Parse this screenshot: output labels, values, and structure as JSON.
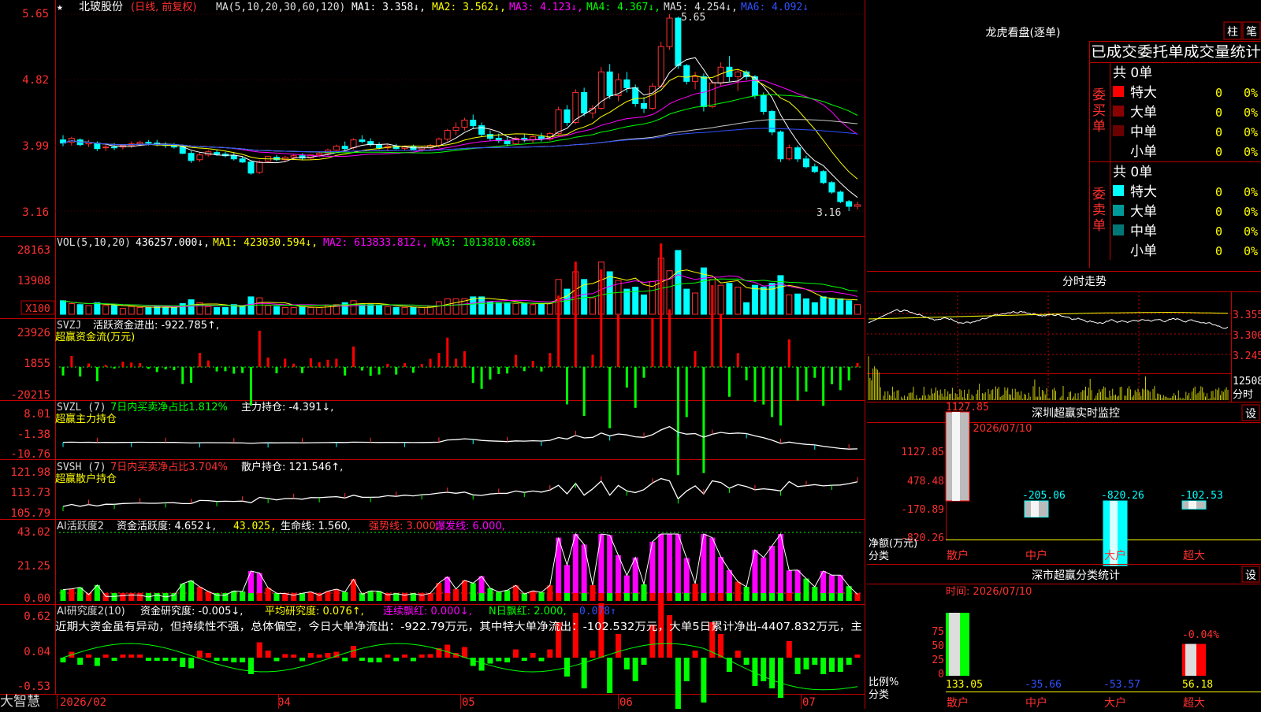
{
  "stock": {
    "star": "★",
    "name": "北玻股份",
    "mode": "(日线, 前复权)",
    "ma_label": "MA(5,10,20,30,60,120)",
    "ma1": "MA1: 3.358↓,",
    "ma2": "MA2: 3.562↓,",
    "ma3": "MA3: 4.123↓,",
    "ma4": "MA4: 4.367↓,",
    "ma5": "MA5: 4.254↓,",
    "ma6": "MA6: 4.092↓"
  },
  "price_axis": [
    "5.65",
    "4.82",
    "3.99",
    "3.16"
  ],
  "price_high_label": "5.65",
  "price_low_label": "3.16",
  "vol": {
    "label": "VOL(5,10,20)",
    "value": "436257.000↓,",
    "ma1": "MA1: 423030.594↓,",
    "ma2": "MA2: 613833.812↓,",
    "ma3": "MA3: 1013810.688↓",
    "axis": [
      "28163",
      "13908"
    ],
    "unit": "X100"
  },
  "svzj": {
    "label": "SVZJ",
    "value": "活跃资金进出: -922.785↑,",
    "sub": "超赢资金流(万元)",
    "axis": [
      "23926",
      "1855",
      "-20215"
    ]
  },
  "svzl": {
    "label": "SVZL (7)",
    "ratio": "7日内买卖净占比1.812%",
    "value": "主力持仓: -4.391↓,",
    "sub": "超赢主力持仓",
    "axis": [
      "8.01",
      "-1.38",
      "-10.76"
    ]
  },
  "svsh": {
    "label": "SVSH (7)",
    "ratio": "7日内买卖净占比3.704%",
    "value": "散户持仓: 121.546↑,",
    "sub": "超赢散户持仓",
    "axis": [
      "121.98",
      "113.73",
      "105.79"
    ]
  },
  "ai1": {
    "label": "AI活跃度2",
    "v1": "资金活跃度: 4.652↓,",
    "v2": "43.025,",
    "v3": "生命线: 1.560,",
    "v4": "强势线: 3.000,",
    "v5": "爆发线: 6.000,",
    "axis": [
      "43.02",
      "21.25",
      "0.00"
    ]
  },
  "ai2": {
    "label": "AI研究度2(10)",
    "v1": "资金研究度: -0.005↓,",
    "v2": "平均研究度: 0.076↑,",
    "v3": "连续飘红: 0.000↓,",
    "v4": "N日飘红: 2.000,",
    "v5": "0.078↑",
    "comment": "近期大资金虽有异动，但持续性不强，总体偏空，今日大单净流出：-922.79万元，其中特大单净流出：-102.532万元，大单5日累计净出-4407.832万元，主",
    "axis": [
      "0.62",
      "0.04",
      "-0.53"
    ]
  },
  "dates": [
    "2026/02",
    "04",
    "05",
    "06",
    "07"
  ],
  "brand": "大智慧",
  "lhb": {
    "title": "龙虎看盘(逐单)",
    "btn_zhu": "柱",
    "btn_bi": "笔",
    "tabs": "已成交委托单成交量统计",
    "buy_label": "委买单",
    "sell_label": "委卖单",
    "buy_total": "共 0单",
    "sell_total": "共 0单",
    "buy_rows": [
      {
        "name": "特大",
        "count": "0",
        "pct": "0%",
        "color": "#ff0000"
      },
      {
        "name": "大单",
        "count": "0",
        "pct": "0%",
        "color": "#8b0000"
      },
      {
        "name": "中单",
        "count": "0",
        "pct": "0%",
        "color": "#6b0000"
      },
      {
        "name": "小单",
        "count": "0",
        "pct": "0%",
        "color": "#000000"
      }
    ],
    "sell_rows": [
      {
        "name": "特大",
        "count": "0",
        "pct": "0%",
        "color": "#00ffff"
      },
      {
        "name": "大单",
        "count": "0",
        "pct": "0%",
        "color": "#009999"
      },
      {
        "name": "中单",
        "count": "0",
        "pct": "0%",
        "color": "#007777"
      },
      {
        "name": "小单",
        "count": "0",
        "pct": "0%",
        "color": "#000000"
      }
    ]
  },
  "fenshi": {
    "title": "分时走势",
    "axis": [
      "3.355",
      "3.300",
      "3.245"
    ],
    "vol_axis": [
      "12508",
      "分时"
    ]
  },
  "monitor": {
    "title": "深圳超赢实时监控",
    "btn": "设",
    "time": "时间: 2026/07/10",
    "axis": [
      "1127.85",
      "478.48",
      "-170.89",
      "-820.26"
    ],
    "ylabel": "净额(万元)",
    "xlabel": "分类",
    "values": [
      "1127.85",
      "-205.06",
      "-820.26",
      "-102.53"
    ],
    "categories": [
      "散户",
      "中户",
      "大户",
      "超大"
    ]
  },
  "classify": {
    "title": "深市超赢分类统计",
    "btn": "设",
    "time": "时间: 2026/07/10",
    "axis": [
      "75",
      "50",
      "25",
      "0"
    ],
    "ylabel": "比例%",
    "xlabel": "分类",
    "top_label": "-0.04%",
    "values": [
      "133.05",
      "-35.66",
      "-53.57",
      "56.18"
    ],
    "categories": [
      "散户",
      "中户",
      "大户",
      "超大"
    ]
  },
  "chart_data": {
    "type": "candlestick",
    "ylim": [
      3.16,
      5.65
    ],
    "candles": [
      {
        "o": 4.06,
        "h": 4.12,
        "l": 3.98,
        "c": 4.02
      },
      {
        "o": 4.03,
        "h": 4.1,
        "l": 3.99,
        "c": 4.08
      },
      {
        "o": 4.06,
        "h": 4.08,
        "l": 3.98,
        "c": 4.0
      },
      {
        "o": 4.01,
        "h": 4.06,
        "l": 3.97,
        "c": 4.03
      },
      {
        "o": 4.02,
        "h": 4.04,
        "l": 3.92,
        "c": 3.95
      },
      {
        "o": 3.96,
        "h": 4.01,
        "l": 3.92,
        "c": 3.97
      },
      {
        "o": 3.97,
        "h": 4.02,
        "l": 3.93,
        "c": 3.96
      },
      {
        "o": 3.97,
        "h": 4.0,
        "l": 3.94,
        "c": 3.99
      },
      {
        "o": 3.99,
        "h": 4.04,
        "l": 3.96,
        "c": 4.01
      },
      {
        "o": 4.01,
        "h": 4.05,
        "l": 3.98,
        "c": 4.03
      },
      {
        "o": 4.03,
        "h": 4.06,
        "l": 3.99,
        "c": 4.02
      },
      {
        "o": 4.02,
        "h": 4.06,
        "l": 3.98,
        "c": 4.0
      },
      {
        "o": 4.0,
        "h": 4.03,
        "l": 3.96,
        "c": 3.99
      },
      {
        "o": 3.99,
        "h": 4.02,
        "l": 3.95,
        "c": 3.97
      },
      {
        "o": 3.97,
        "h": 3.99,
        "l": 3.88,
        "c": 3.89
      },
      {
        "o": 3.89,
        "h": 3.92,
        "l": 3.77,
        "c": 3.8
      },
      {
        "o": 3.81,
        "h": 3.9,
        "l": 3.78,
        "c": 3.87
      },
      {
        "o": 3.87,
        "h": 3.93,
        "l": 3.85,
        "c": 3.91
      },
      {
        "o": 3.9,
        "h": 3.93,
        "l": 3.86,
        "c": 3.88
      },
      {
        "o": 3.88,
        "h": 3.91,
        "l": 3.84,
        "c": 3.86
      },
      {
        "o": 3.86,
        "h": 3.9,
        "l": 3.8,
        "c": 3.82
      },
      {
        "o": 3.82,
        "h": 3.85,
        "l": 3.77,
        "c": 3.78
      },
      {
        "o": 3.78,
        "h": 3.8,
        "l": 3.62,
        "c": 3.64
      },
      {
        "o": 3.65,
        "h": 3.8,
        "l": 3.63,
        "c": 3.78
      },
      {
        "o": 3.79,
        "h": 3.86,
        "l": 3.77,
        "c": 3.85
      },
      {
        "o": 3.84,
        "h": 3.87,
        "l": 3.79,
        "c": 3.81
      },
      {
        "o": 3.81,
        "h": 3.86,
        "l": 3.79,
        "c": 3.84
      },
      {
        "o": 3.84,
        "h": 3.88,
        "l": 3.81,
        "c": 3.86
      },
      {
        "o": 3.86,
        "h": 3.89,
        "l": 3.81,
        "c": 3.83
      },
      {
        "o": 3.83,
        "h": 3.88,
        "l": 3.81,
        "c": 3.87
      },
      {
        "o": 3.87,
        "h": 3.91,
        "l": 3.84,
        "c": 3.89
      },
      {
        "o": 3.89,
        "h": 3.95,
        "l": 3.86,
        "c": 3.93
      },
      {
        "o": 3.93,
        "h": 4.0,
        "l": 3.9,
        "c": 3.98
      },
      {
        "o": 3.98,
        "h": 4.04,
        "l": 3.92,
        "c": 3.95
      },
      {
        "o": 3.96,
        "h": 4.08,
        "l": 3.94,
        "c": 4.06
      },
      {
        "o": 4.06,
        "h": 4.12,
        "l": 4.02,
        "c": 4.04
      },
      {
        "o": 4.04,
        "h": 4.08,
        "l": 3.98,
        "c": 4.0
      },
      {
        "o": 4.0,
        "h": 4.03,
        "l": 3.94,
        "c": 3.96
      },
      {
        "o": 3.96,
        "h": 4.0,
        "l": 3.92,
        "c": 3.98
      },
      {
        "o": 3.98,
        "h": 4.01,
        "l": 3.94,
        "c": 3.95
      },
      {
        "o": 3.95,
        "h": 3.99,
        "l": 3.92,
        "c": 3.97
      },
      {
        "o": 3.97,
        "h": 4.0,
        "l": 3.93,
        "c": 3.94
      },
      {
        "o": 3.94,
        "h": 3.98,
        "l": 3.91,
        "c": 3.96
      },
      {
        "o": 3.96,
        "h": 4.01,
        "l": 3.93,
        "c": 3.99
      },
      {
        "o": 3.99,
        "h": 4.09,
        "l": 3.96,
        "c": 4.07
      },
      {
        "o": 4.07,
        "h": 4.2,
        "l": 4.04,
        "c": 4.18
      },
      {
        "o": 4.18,
        "h": 4.28,
        "l": 4.12,
        "c": 4.22
      },
      {
        "o": 4.22,
        "h": 4.34,
        "l": 4.18,
        "c": 4.31
      },
      {
        "o": 4.31,
        "h": 4.38,
        "l": 4.2,
        "c": 4.24
      },
      {
        "o": 4.24,
        "h": 4.28,
        "l": 4.1,
        "c": 4.13
      },
      {
        "o": 4.13,
        "h": 4.18,
        "l": 4.05,
        "c": 4.08
      },
      {
        "o": 4.08,
        "h": 4.14,
        "l": 4.02,
        "c": 4.05
      },
      {
        "o": 4.05,
        "h": 4.1,
        "l": 3.98,
        "c": 4.01
      },
      {
        "o": 4.01,
        "h": 4.1,
        "l": 3.99,
        "c": 4.08
      },
      {
        "o": 4.08,
        "h": 4.14,
        "l": 4.03,
        "c": 4.06
      },
      {
        "o": 4.06,
        "h": 4.12,
        "l": 4.02,
        "c": 4.1
      },
      {
        "o": 4.1,
        "h": 4.15,
        "l": 4.04,
        "c": 4.07
      },
      {
        "o": 4.07,
        "h": 4.16,
        "l": 4.05,
        "c": 4.14
      },
      {
        "o": 4.14,
        "h": 4.48,
        "l": 4.12,
        "c": 4.44
      },
      {
        "o": 4.44,
        "h": 4.5,
        "l": 4.24,
        "c": 4.28
      },
      {
        "o": 4.28,
        "h": 4.7,
        "l": 4.26,
        "c": 4.66
      },
      {
        "o": 4.66,
        "h": 4.72,
        "l": 4.36,
        "c": 4.4
      },
      {
        "o": 4.4,
        "h": 4.5,
        "l": 4.33,
        "c": 4.46
      },
      {
        "o": 4.46,
        "h": 4.98,
        "l": 4.44,
        "c": 4.92
      },
      {
        "o": 4.92,
        "h": 5.02,
        "l": 4.58,
        "c": 4.62
      },
      {
        "o": 4.62,
        "h": 4.9,
        "l": 4.55,
        "c": 4.82
      },
      {
        "o": 4.82,
        "h": 4.92,
        "l": 4.66,
        "c": 4.72
      },
      {
        "o": 4.72,
        "h": 4.76,
        "l": 4.48,
        "c": 4.52
      },
      {
        "o": 4.52,
        "h": 4.6,
        "l": 4.4,
        "c": 4.46
      },
      {
        "o": 4.46,
        "h": 4.78,
        "l": 4.44,
        "c": 4.74
      },
      {
        "o": 4.74,
        "h": 5.3,
        "l": 4.72,
        "c": 5.24
      },
      {
        "o": 5.24,
        "h": 5.65,
        "l": 5.2,
        "c": 5.6
      },
      {
        "o": 5.6,
        "h": 5.62,
        "l": 4.96,
        "c": 5.0
      },
      {
        "o": 5.0,
        "h": 5.02,
        "l": 4.76,
        "c": 4.8
      },
      {
        "o": 4.8,
        "h": 4.92,
        "l": 4.7,
        "c": 4.86
      },
      {
        "o": 4.86,
        "h": 4.9,
        "l": 4.42,
        "c": 4.48
      },
      {
        "o": 4.48,
        "h": 4.82,
        "l": 4.46,
        "c": 4.78
      },
      {
        "o": 4.78,
        "h": 5.04,
        "l": 4.74,
        "c": 4.98
      },
      {
        "o": 4.98,
        "h": 5.12,
        "l": 4.8,
        "c": 4.86
      },
      {
        "o": 4.86,
        "h": 4.96,
        "l": 4.68,
        "c": 4.92
      },
      {
        "o": 4.92,
        "h": 4.94,
        "l": 4.82,
        "c": 4.86
      },
      {
        "o": 4.86,
        "h": 4.88,
        "l": 4.58,
        "c": 4.62
      },
      {
        "o": 4.62,
        "h": 4.66,
        "l": 4.38,
        "c": 4.42
      },
      {
        "o": 4.42,
        "h": 4.44,
        "l": 4.12,
        "c": 4.16
      },
      {
        "o": 4.16,
        "h": 4.18,
        "l": 3.78,
        "c": 3.82
      },
      {
        "o": 3.82,
        "h": 4.0,
        "l": 3.8,
        "c": 3.96
      },
      {
        "o": 3.96,
        "h": 3.99,
        "l": 3.78,
        "c": 3.82
      },
      {
        "o": 3.82,
        "h": 3.86,
        "l": 3.7,
        "c": 3.72
      },
      {
        "o": 3.72,
        "h": 3.76,
        "l": 3.64,
        "c": 3.66
      },
      {
        "o": 3.66,
        "h": 3.68,
        "l": 3.5,
        "c": 3.52
      },
      {
        "o": 3.52,
        "h": 3.54,
        "l": 3.38,
        "c": 3.4
      },
      {
        "o": 3.4,
        "h": 3.42,
        "l": 3.26,
        "c": 3.28
      },
      {
        "o": 3.28,
        "h": 3.3,
        "l": 3.16,
        "c": 3.22
      },
      {
        "o": 3.22,
        "h": 3.28,
        "l": 3.18,
        "c": 3.24
      }
    ]
  }
}
